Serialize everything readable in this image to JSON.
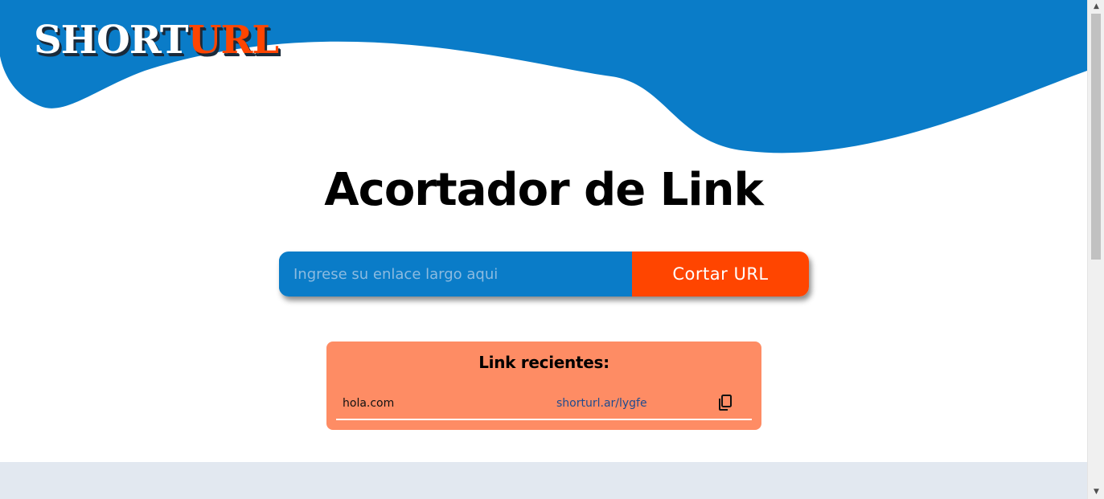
{
  "header": {
    "logo_part1": "SHORT",
    "logo_part2": "URL"
  },
  "main": {
    "title": "Acortador de Link",
    "input_placeholder": "Ingrese su enlace largo aqui",
    "input_value": "",
    "submit_label": "Cortar URL"
  },
  "recent": {
    "heading": "Link recientes:",
    "items": [
      {
        "original": "hola.com",
        "short": "shorturl.ar/lygfe",
        "action_icon": "copy-icon"
      }
    ]
  },
  "colors": {
    "brand_blue": "#0a7cc8",
    "accent_orange": "#ff4500",
    "recent_bg": "#fe8c64",
    "footer_bg": "#e2e8f0"
  }
}
